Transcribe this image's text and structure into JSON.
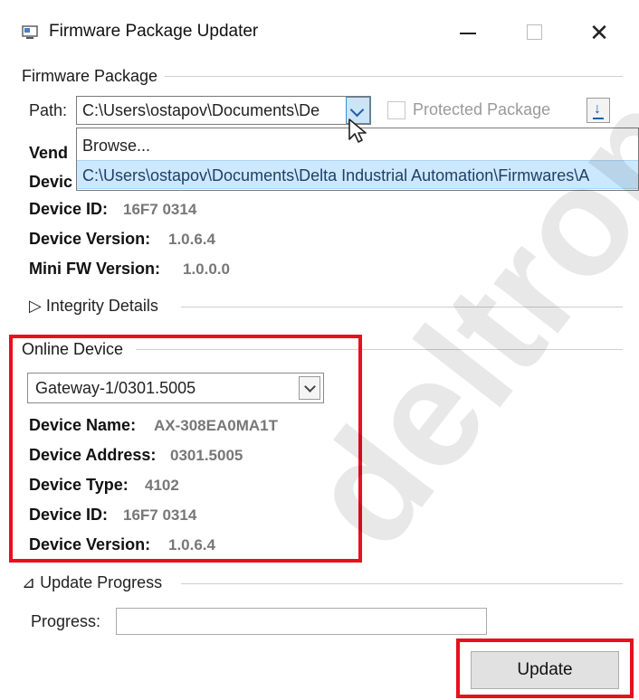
{
  "window": {
    "title": "Firmware Package Updater",
    "close_glyph": "✕"
  },
  "firmware_package": {
    "group_title": "Firmware Package",
    "path_label": "Path:",
    "path_value": "C:\\Users\\ostapov\\Documents\\De",
    "protected_label": "Protected Package",
    "protected_checked": false,
    "dropdown_items": [
      "Browse...",
      "C:\\Users\\ostapov\\Documents\\Delta Industrial Automation\\Firmwares\\A"
    ],
    "partial_labels": [
      "Vend",
      "Devic"
    ],
    "fields": [
      {
        "label": "Device ID:",
        "value": "16F7 0314"
      },
      {
        "label": "Device Version:",
        "value": "1.0.6.4"
      },
      {
        "label": "Mini FW Version:",
        "value": "1.0.0.0"
      }
    ],
    "integrity_label": "Integrity Details",
    "integrity_glyph": "▷"
  },
  "online_device": {
    "group_title": "Online Device",
    "selected_device": "Gateway-1/0301.5005",
    "fields": [
      {
        "label": "Device Name:",
        "value": "AX-308EA0MA1T"
      },
      {
        "label": "Device Address:",
        "value": "0301.5005"
      },
      {
        "label": "Device Type:",
        "value": "4102"
      },
      {
        "label": "Device ID:",
        "value": "16F7 0314"
      },
      {
        "label": "Device Version:",
        "value": "1.0.6.4"
      }
    ]
  },
  "update_progress": {
    "group_title": "Update Progress",
    "collapse_glyph": "⊿",
    "progress_label": "Progress:",
    "progress_value": 0,
    "update_button": "Update"
  },
  "watermark": "deltron",
  "colors": {
    "highlight": "#e8101e",
    "selection": "#cce8ff"
  }
}
